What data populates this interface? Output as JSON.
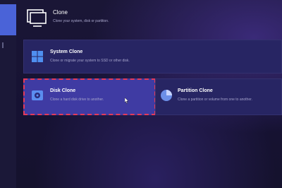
{
  "header": {
    "title": "Clone",
    "subtitle": "Clone your system, disk or partition."
  },
  "cards": [
    {
      "id": "system-clone",
      "title": "System Clone",
      "description": "Clone or migrate your system to SSD or other disk.",
      "icon": "windows-logo-icon",
      "selected": false
    },
    {
      "id": "disk-clone",
      "title": "Disk Clone",
      "description": "Clone a hard disk drive to another.",
      "icon": "disk-icon",
      "selected": true
    },
    {
      "id": "partition-clone",
      "title": "Partition Clone",
      "description": "Clone a partition or volume from one to another.",
      "icon": "pie-chart-icon",
      "selected": false
    }
  ],
  "colors": {
    "accent": "#4a63d8",
    "card_bg": "#272563",
    "selected_card_bg": "#3f3ba3",
    "selection_border": "#e33a5a"
  }
}
